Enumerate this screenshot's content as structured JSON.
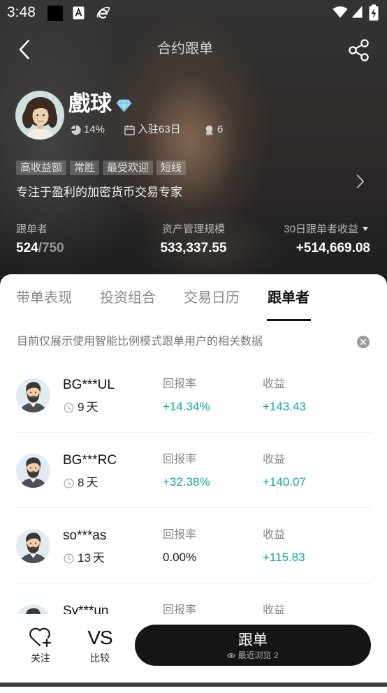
{
  "status_bar": {
    "time": "3:48",
    "left_icons": [
      "notification-square-icon",
      "a-badge-icon",
      "e-browser-icon"
    ],
    "right_icons": [
      "wifi-icon",
      "cell-signal-icon",
      "battery-charging-icon"
    ]
  },
  "header": {
    "title": "合约跟单",
    "back_icon": "back-arrow-icon",
    "share_icon": "share-icon"
  },
  "profile": {
    "avatar": "trader-portrait-avatar",
    "name": "戲球",
    "badge_icon": "diamond-badge-icon",
    "stat_icons": [
      "pie-chart-icon",
      "calendar-icon",
      "medal-icon"
    ],
    "win_rate": "14%",
    "joined": "入驻63日",
    "medals": "6",
    "tags": [
      "高收益额",
      "常胜",
      "最受欢迎",
      "短线"
    ],
    "description": "专注于盈利的加密货币交易专家",
    "more_icon": "chevron-right-icon"
  },
  "stats": {
    "followers": {
      "label": "跟单者",
      "current": "524",
      "max": "/750"
    },
    "aum": {
      "label": "资产管理规模",
      "value": "533,337.55"
    },
    "follower_pnl_30d": {
      "label": "30日跟单者收益",
      "value": "+514,669.08",
      "dropdown_icon": "caret-down-icon"
    }
  },
  "tabs": [
    {
      "label": "带单表现",
      "active": false
    },
    {
      "label": "投资组合",
      "active": false
    },
    {
      "label": "交易日历",
      "active": false
    },
    {
      "label": "跟单者",
      "active": true
    }
  ],
  "notice": {
    "text": "目前仅展示使用智能比例模式跟单用户的相关数据",
    "close_icon": "close-circle-icon"
  },
  "followers_list": {
    "columns": {
      "roi": "回报率",
      "profit": "收益"
    },
    "rows": [
      {
        "name": "BG***UL",
        "days": "9",
        "days_unit": "天",
        "roi": "+14.34%",
        "roi_color": "#14a4a8",
        "profit": "+143.43",
        "profit_color": "#14a4a8"
      },
      {
        "name": "BG***RC",
        "days": "8",
        "days_unit": "天",
        "roi": "+32.38%",
        "roi_color": "#14a4a8",
        "profit": "+140.07",
        "profit_color": "#14a4a8"
      },
      {
        "name": "so***as",
        "days": "13",
        "days_unit": "天",
        "roi": "0.00%",
        "roi_color": "#1a1a1a",
        "profit": "+115.83",
        "profit_color": "#14a4a8"
      },
      {
        "name": "Sy***un"
      }
    ]
  },
  "bottom_bar": {
    "follow": {
      "icon": "heart-plus-icon",
      "label": "关注"
    },
    "compare": {
      "icon_text": "VS",
      "label": "比较"
    },
    "copy_button": {
      "label": "跟单",
      "views_icon": "eye-icon",
      "views_label": "最近浏览",
      "views_count": "2"
    }
  },
  "colors": {
    "accent_up": "#14a4a8",
    "button_bg": "#151515",
    "text_primary": "#1a1a1a"
  }
}
